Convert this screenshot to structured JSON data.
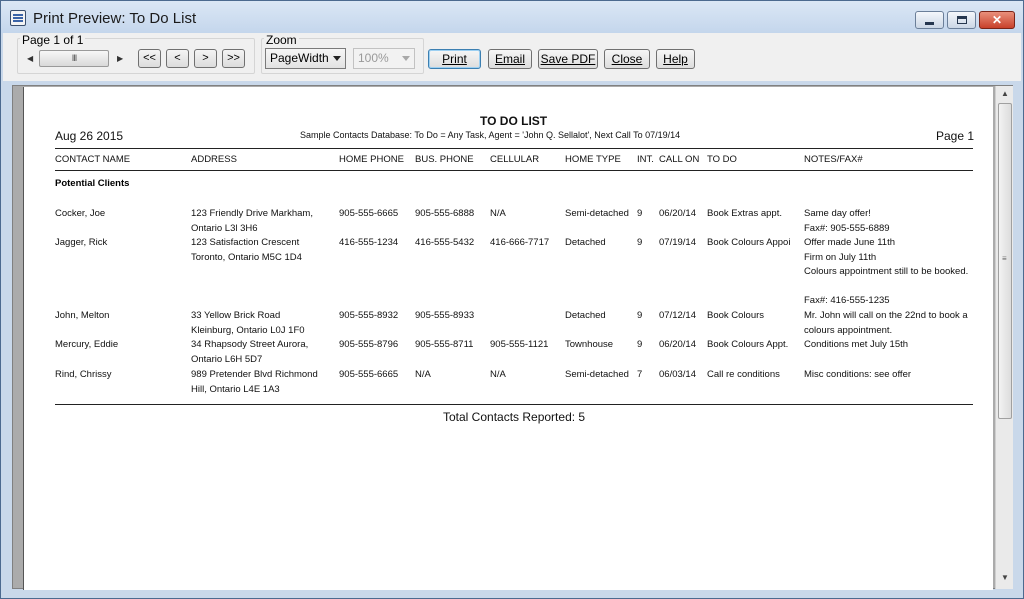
{
  "window": {
    "title": "Print Preview: To Do List",
    "minimize_icon": "minimize-icon",
    "maximize_icon": "maximize-icon",
    "close_glyph": "✕"
  },
  "toolbar": {
    "page_group_label": "Page 1 of 1",
    "scroll_thumb_glyph": "III",
    "first_label": "<<",
    "prev_label": "<",
    "next_label": ">",
    "last_label": ">>",
    "zoom_group_label": "Zoom",
    "zoom_mode": "PageWidth",
    "zoom_percent": "100%",
    "print_label": "Print",
    "email_label": "Email",
    "save_pdf_label": "Save PDF",
    "close_label": "Close",
    "help_label": "Help"
  },
  "report": {
    "title": "TO DO LIST",
    "subtitle": "Sample Contacts Database: To Do = Any Task, Agent = 'John Q. Sellalot', Next Call To 07/19/14",
    "date": "Aug 26 2015",
    "page": "Page 1",
    "columns": [
      "CONTACT NAME",
      "ADDRESS",
      "HOME PHONE",
      "BUS. PHONE",
      "CELLULAR",
      "HOME TYPE",
      "INT.",
      "CALL ON",
      "TO DO",
      "NOTES/FAX#"
    ],
    "section": "Potential Clients",
    "rows": [
      {
        "name": "Cocker, Joe",
        "address": [
          "123 Friendly Drive Markham,",
          "Ontario L3l 3H6"
        ],
        "home_phone": "905-555-6665",
        "bus_phone": "905-555-6888",
        "cellular": "N/A",
        "home_type": "Semi-detached",
        "int": "9",
        "call_on": "06/20/14",
        "todo": "Book Extras appt.",
        "notes": [
          "Same day offer!",
          "Fax#: 905-555-6889"
        ]
      },
      {
        "name": "Jagger, Rick",
        "address": [
          "123 Satisfaction Crescent",
          "Toronto, Ontario M5C 1D4"
        ],
        "home_phone": "416-555-1234",
        "bus_phone": "416-555-5432",
        "cellular": "416-666-7717",
        "home_type": "Detached",
        "int": "9",
        "call_on": "07/19/14",
        "todo": "Book Colours Appoi",
        "notes": [
          "Offer made June 11th",
          "Firm on July 11th",
          "Colours appointment still to be booked.",
          "Fax#: 416-555-1235"
        ]
      },
      {
        "name": "John, Melton",
        "address": [
          "33 Yellow Brick Road",
          "Kleinburg, Ontario L0J 1F0"
        ],
        "home_phone": "905-555-8932",
        "bus_phone": "905-555-8933",
        "cellular": "",
        "home_type": "Detached",
        "int": "9",
        "call_on": "07/12/14",
        "todo": "Book Colours",
        "notes": [
          "Mr. John will call on the 22nd to book a colours appointment."
        ]
      },
      {
        "name": "Mercury, Eddie",
        "address": [
          "34 Rhapsody Street Aurora,",
          "Ontario L6H 5D7"
        ],
        "home_phone": "905-555-8796",
        "bus_phone": "905-555-8711",
        "cellular": "905-555-1121",
        "home_type": "Townhouse",
        "int": "9",
        "call_on": "06/20/14",
        "todo": "Book Colours Appt.",
        "notes": [
          "Conditions met July 15th"
        ]
      },
      {
        "name": "Rind, Chrissy",
        "address": [
          "989 Pretender Blvd Richmond",
          "Hill, Ontario L4E 1A3"
        ],
        "home_phone": "905-555-6665",
        "bus_phone": "N/A",
        "cellular": "N/A",
        "home_type": "Semi-detached",
        "int": "7",
        "call_on": "06/03/14",
        "todo": "Call re conditions",
        "notes": [
          "Misc conditions: see offer"
        ]
      }
    ],
    "total": "Total Contacts Reported: 5"
  }
}
